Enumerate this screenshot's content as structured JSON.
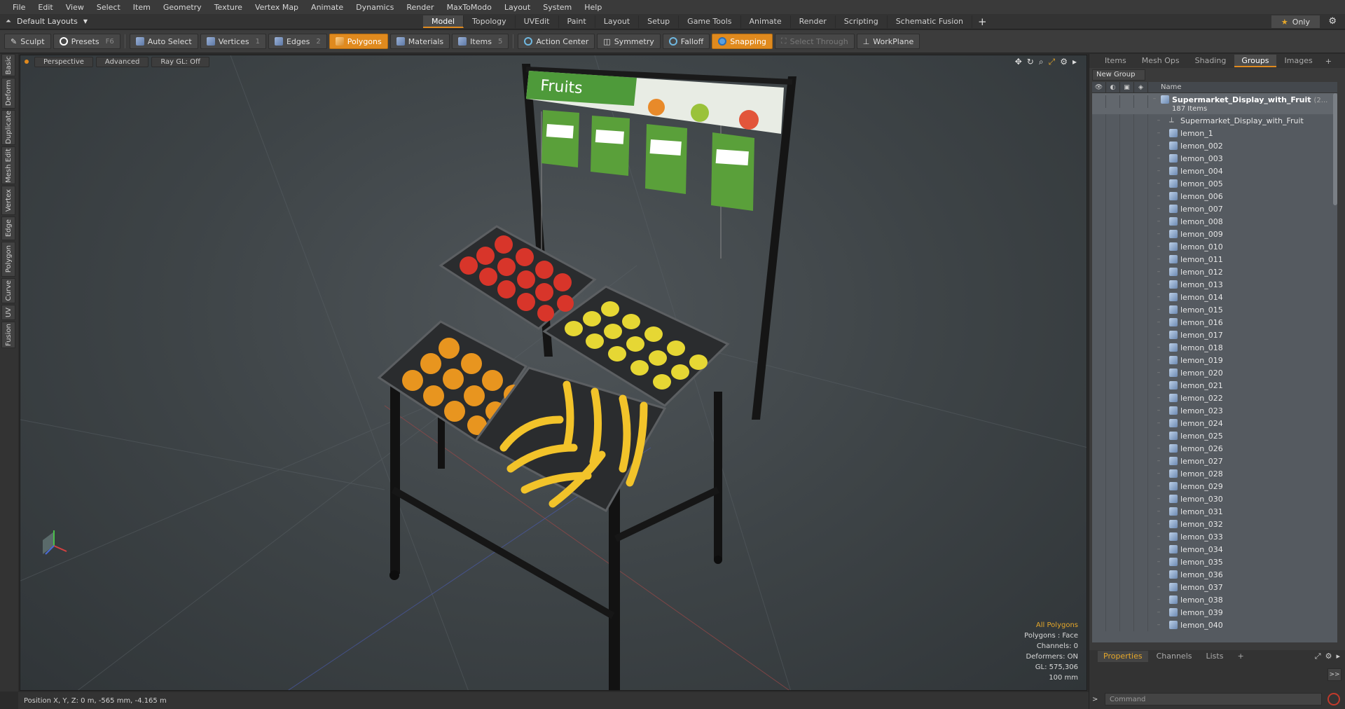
{
  "menu": [
    "File",
    "Edit",
    "View",
    "Select",
    "Item",
    "Geometry",
    "Texture",
    "Vertex Map",
    "Animate",
    "Dynamics",
    "Render",
    "MaxToModo",
    "Layout",
    "System",
    "Help"
  ],
  "layout_select": "Default Layouts",
  "tabs": [
    "Model",
    "Topology",
    "UVEdit",
    "Paint",
    "Layout",
    "Setup",
    "Game Tools",
    "Animate",
    "Render",
    "Scripting",
    "Schematic Fusion"
  ],
  "active_tab": "Model",
  "only_label": "Only",
  "toolbar": {
    "sculpt": "Sculpt",
    "presets": "Presets",
    "presets_key": "F6",
    "auto_select": "Auto Select",
    "vertices": "Vertices",
    "vertices_key": "1",
    "edges": "Edges",
    "edges_key": "2",
    "polygons": "Polygons",
    "materials": "Materials",
    "items": "Items",
    "items_key": "5",
    "action_center": "Action Center",
    "symmetry": "Symmetry",
    "falloff": "Falloff",
    "snapping": "Snapping",
    "select_through": "Select Through",
    "workplane": "WorkPlane"
  },
  "left_tabs": [
    "Basic",
    "Deform",
    "Duplicate",
    "Mesh Edit",
    "Vertex",
    "Edge",
    "Polygon",
    "Curve",
    "UV",
    "Fusion"
  ],
  "viewport": {
    "view": "Perspective",
    "shading": "Advanced",
    "raygl": "Ray GL: Off",
    "sign_text": "Fruits",
    "stats": {
      "mode": "All Polygons",
      "polygons": "Polygons : Face",
      "channels": "Channels: 0",
      "deformers": "Deformers: ON",
      "gl": "GL: 575,306",
      "scale": "100 mm"
    }
  },
  "statusbar": "Position X, Y, Z:  0 m, -565 mm, -4.165 m",
  "right_panel": {
    "tabs": [
      "Items",
      "Mesh Ops",
      "Shading",
      "Groups",
      "Images"
    ],
    "active_tab": "Groups",
    "new_group": "New Group",
    "name_header": "Name",
    "root_name": "Supermarket_Display_with_Fruit",
    "root_tail": "(2...",
    "root_count": "187 Items",
    "children": [
      "Supermarket_Display_with_Fruit",
      "lemon_1",
      "lemon_002",
      "lemon_003",
      "lemon_004",
      "lemon_005",
      "lemon_006",
      "lemon_007",
      "lemon_008",
      "lemon_009",
      "lemon_010",
      "lemon_011",
      "lemon_012",
      "lemon_013",
      "lemon_014",
      "lemon_015",
      "lemon_016",
      "lemon_017",
      "lemon_018",
      "lemon_019",
      "lemon_020",
      "lemon_021",
      "lemon_022",
      "lemon_023",
      "lemon_024",
      "lemon_025",
      "lemon_026",
      "lemon_027",
      "lemon_028",
      "lemon_029",
      "lemon_030",
      "lemon_031",
      "lemon_032",
      "lemon_033",
      "lemon_034",
      "lemon_035",
      "lemon_036",
      "lemon_037",
      "lemon_038",
      "lemon_039",
      "lemon_040"
    ],
    "bottom_tabs": [
      "Properties",
      "Channels",
      "Lists"
    ],
    "bottom_active": "Properties",
    "command_placeholder": "Command"
  }
}
